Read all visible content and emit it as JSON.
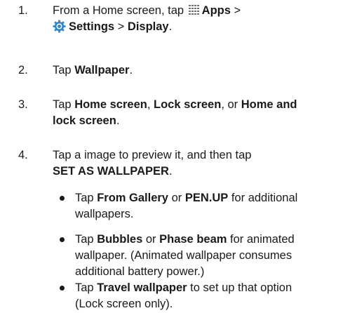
{
  "colors": {
    "text": "#1a1a1a",
    "apps_icon": "#6f6f6f",
    "settings_icon": "#2e86c9"
  },
  "icons": [
    "apps-grid-icon",
    "settings-gear-icon"
  ],
  "steps": [
    {
      "number": "1.",
      "t1": "From a Home screen, tap ",
      "apps": "Apps",
      "sep1": " >",
      "settings": "Settings",
      "sep2": " > ",
      "display": "Display",
      "end": "."
    },
    {
      "number": "2.",
      "t1": "Tap ",
      "wallpaper": "Wallpaper",
      "end": "."
    },
    {
      "number": "3.",
      "t1": "Tap ",
      "home": "Home screen",
      "c1": ", ",
      "lock": "Lock screen",
      "c2": ", or ",
      "homelock_a": "Home and",
      "homelock_b": "lock screen",
      "end": "."
    },
    {
      "number": "4.",
      "line1": "Tap a image to preview it, and then tap",
      "set": "SET AS WALLPAPER",
      "end": "."
    }
  ],
  "bullets": [
    {
      "t1": "Tap ",
      "gallery": "From Gallery",
      "or": " or ",
      "penup": "PEN.UP",
      "t2": " for additional",
      "line2": "wallpapers."
    },
    {
      "t1": "Tap ",
      "bubbles": "Bubbles",
      "or": " or ",
      "phase": "Phase beam",
      "t2": " for animated",
      "line2": "wallpaper. (Animated wallpaper consumes",
      "line3": "additional battery power.)"
    },
    {
      "t1": "Tap ",
      "travel": "Travel wallpaper",
      "t2": " to set up that option",
      "line2": "(Lock screen only)."
    }
  ]
}
